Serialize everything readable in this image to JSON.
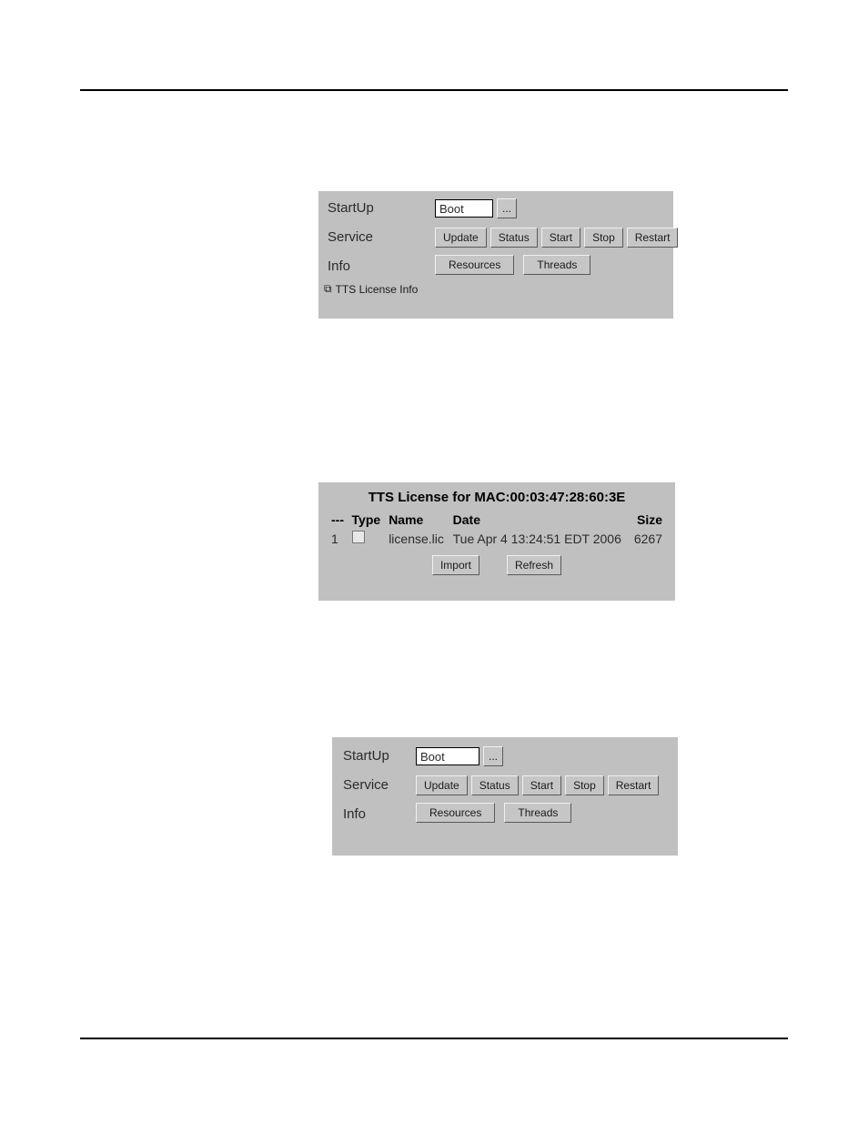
{
  "panel1": {
    "labels": {
      "startup": "StartUp",
      "service": "Service",
      "info": "Info"
    },
    "startup_value": "Boot",
    "ellipsis": "...",
    "buttons": {
      "update": "Update",
      "status": "Status",
      "start": "Start",
      "stop": "Stop",
      "restart": "Restart",
      "resources": "Resources",
      "threads": "Threads"
    },
    "sublink": {
      "icon": "window-icon",
      "label": "TTS License Info"
    }
  },
  "panel2": {
    "title": "TTS License for MAC:00:03:47:28:60:3E",
    "headers": {
      "dash": "---",
      "type": "Type",
      "name": "Name",
      "date": "Date",
      "size": "Size"
    },
    "rows": [
      {
        "num": "1",
        "type_icon": "file-icon",
        "name": "license.lic",
        "date": "Tue Apr 4 13:24:51 EDT 2006",
        "size": "6267"
      }
    ],
    "buttons": {
      "import": "Import",
      "refresh": "Refresh"
    }
  },
  "panel3": {
    "labels": {
      "startup": "StartUp",
      "service": "Service",
      "info": "Info"
    },
    "startup_value": "Boot",
    "ellipsis": "...",
    "buttons": {
      "update": "Update",
      "status": "Status",
      "start": "Start",
      "stop": "Stop",
      "restart": "Restart",
      "resources": "Resources",
      "threads": "Threads"
    }
  }
}
